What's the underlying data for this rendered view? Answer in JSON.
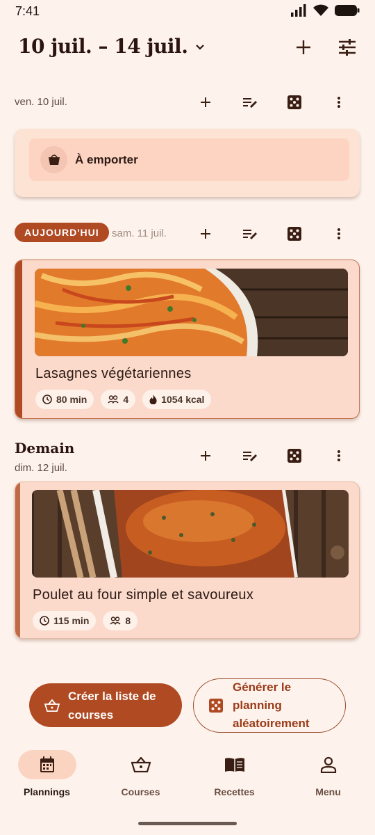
{
  "status_bar": {
    "time": "7:41"
  },
  "header": {
    "title": "10 juil. – 14 juil."
  },
  "days": [
    {
      "label": "ven. 10 juil.",
      "card": {
        "title": "À emporter"
      }
    },
    {
      "badge": "AUJOURD'HUI",
      "label": "sam. 11 juil.",
      "card": {
        "title": "Lasagnes végétariennes",
        "time": "80 min",
        "servings": "4",
        "kcal": "1054 kcal"
      }
    },
    {
      "heading": "Demain",
      "label": "dim. 12 juil.",
      "card": {
        "title": "Poulet au four simple et savoureux",
        "time": "115 min",
        "servings": "8"
      }
    }
  ],
  "actions": {
    "shopping_list": "Créer la liste de courses",
    "random_planning": "Générer le planning aléatoirement"
  },
  "nav": [
    {
      "label": "Plannings",
      "icon": "calendar-icon",
      "active": true
    },
    {
      "label": "Courses",
      "icon": "basket-icon"
    },
    {
      "label": "Recettes",
      "icon": "book-icon"
    },
    {
      "label": "Menu",
      "icon": "person-icon"
    }
  ],
  "colors": {
    "accent": "#b04a22",
    "background": "#fdf3ec",
    "card": "#fbdacb"
  }
}
